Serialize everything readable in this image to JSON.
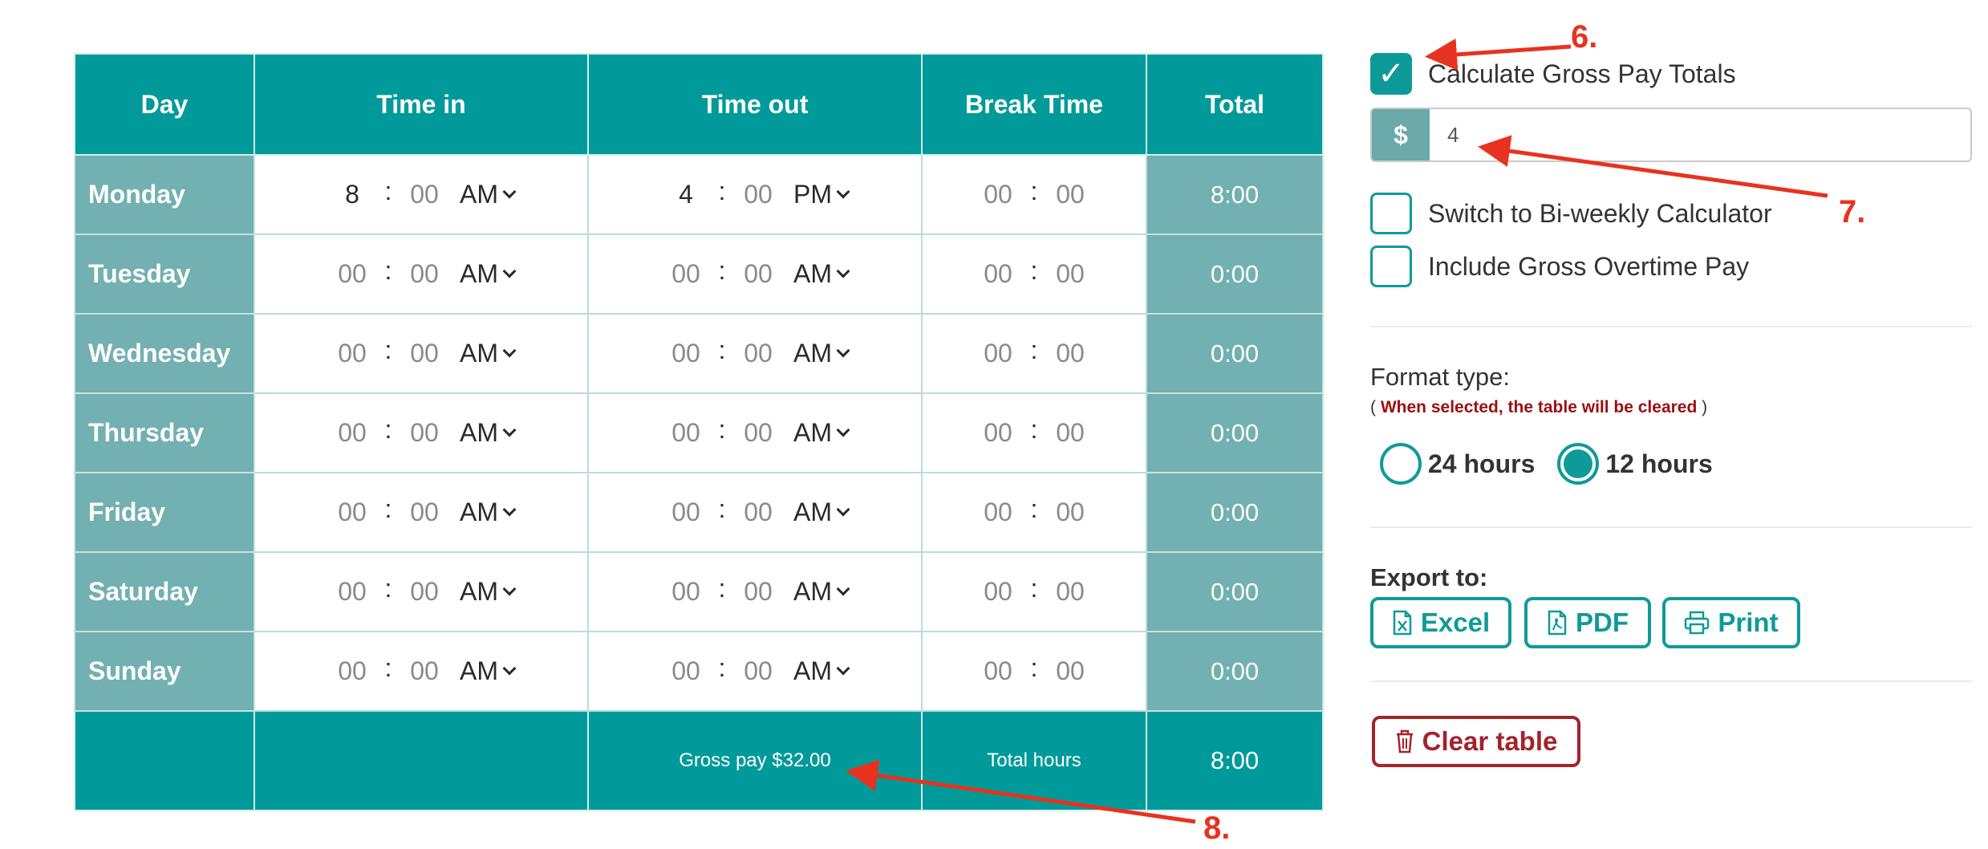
{
  "table": {
    "headers": [
      "Day",
      "Time in",
      "Time out",
      "Break Time",
      "Total"
    ],
    "rows": [
      {
        "day": "Monday",
        "in_h": "8",
        "in_m": "00",
        "in_ap": "AM",
        "out_h": "4",
        "out_m": "00",
        "out_ap": "PM",
        "br_h": "00",
        "br_m": "00",
        "total": "8:00"
      },
      {
        "day": "Tuesday",
        "in_h": "00",
        "in_m": "00",
        "in_ap": "AM",
        "out_h": "00",
        "out_m": "00",
        "out_ap": "AM",
        "br_h": "00",
        "br_m": "00",
        "total": "0:00"
      },
      {
        "day": "Wednesday",
        "in_h": "00",
        "in_m": "00",
        "in_ap": "AM",
        "out_h": "00",
        "out_m": "00",
        "out_ap": "AM",
        "br_h": "00",
        "br_m": "00",
        "total": "0:00"
      },
      {
        "day": "Thursday",
        "in_h": "00",
        "in_m": "00",
        "in_ap": "AM",
        "out_h": "00",
        "out_m": "00",
        "out_ap": "AM",
        "br_h": "00",
        "br_m": "00",
        "total": "0:00"
      },
      {
        "day": "Friday",
        "in_h": "00",
        "in_m": "00",
        "in_ap": "AM",
        "out_h": "00",
        "out_m": "00",
        "out_ap": "AM",
        "br_h": "00",
        "br_m": "00",
        "total": "0:00"
      },
      {
        "day": "Saturday",
        "in_h": "00",
        "in_m": "00",
        "in_ap": "AM",
        "out_h": "00",
        "out_m": "00",
        "out_ap": "AM",
        "br_h": "00",
        "br_m": "00",
        "total": "0:00"
      },
      {
        "day": "Sunday",
        "in_h": "00",
        "in_m": "00",
        "in_ap": "AM",
        "out_h": "00",
        "out_m": "00",
        "out_ap": "AM",
        "br_h": "00",
        "br_m": "00",
        "total": "0:00"
      }
    ],
    "colon": ":",
    "footer": {
      "gross_pay": "Gross pay $32.00",
      "total_hours_label": "Total hours",
      "total_hours_value": "8:00"
    }
  },
  "panel": {
    "calc_gross": {
      "label": "Calculate Gross Pay Totals",
      "checked": true,
      "check_glyph": "✓"
    },
    "rate": {
      "symbol": "$",
      "value": "4"
    },
    "biweekly": {
      "label": "Switch to Bi-weekly Calculator",
      "checked": false
    },
    "overtime": {
      "label": "Include Gross Overtime Pay",
      "checked": false
    },
    "format": {
      "title": "Format type:",
      "note_open": "(",
      "note_warn": "When selected, the table will be cleared",
      "note_close": ")",
      "options": [
        {
          "label": "24 hours",
          "selected": false
        },
        {
          "label": "12 hours",
          "selected": true
        }
      ]
    },
    "export": {
      "title": "Export to:",
      "buttons": {
        "excel": "Excel",
        "pdf": "PDF",
        "print": "Print"
      }
    },
    "clear": "Clear table"
  },
  "callouts": {
    "six": "6.",
    "seven": "7.",
    "eight": "8."
  },
  "colors": {
    "teal": "#009a9b",
    "teal_muted": "#72b0b1",
    "danger": "#a3232c",
    "annotation": "#e8321f"
  },
  "icons": {
    "excel": "excel-file-icon",
    "pdf": "pdf-file-icon",
    "print": "printer-icon",
    "clear": "trash-icon"
  }
}
